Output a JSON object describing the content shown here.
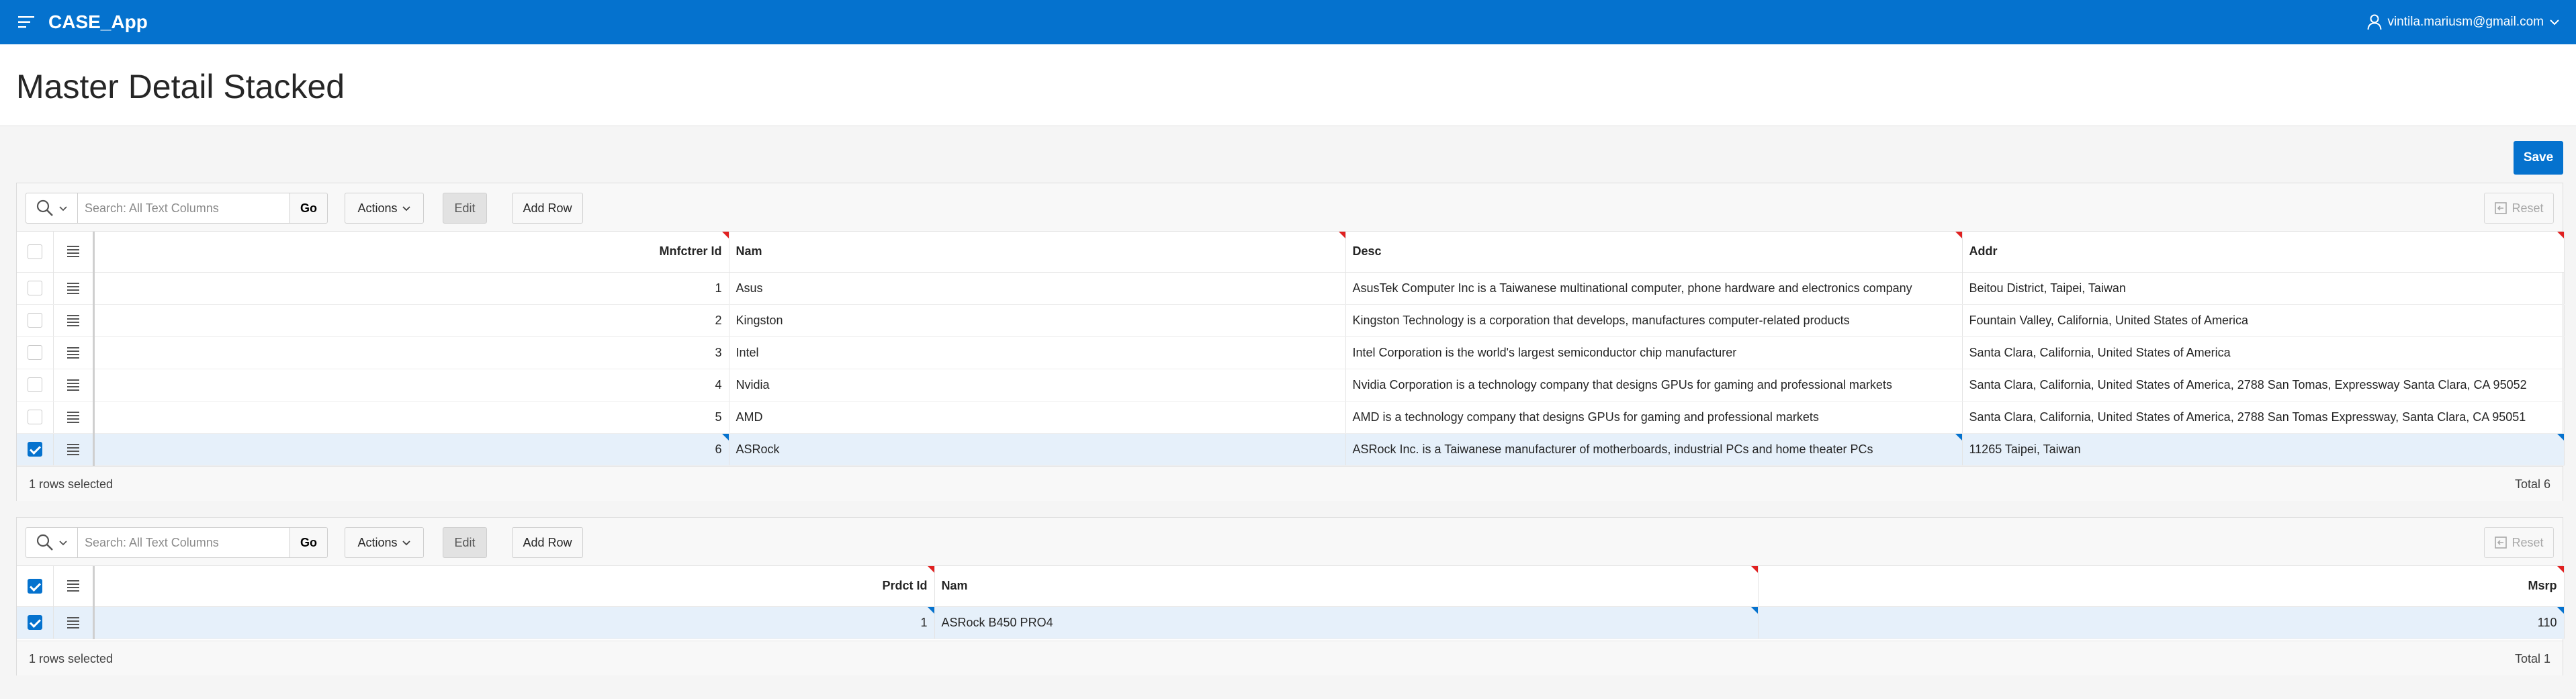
{
  "app": {
    "title": "CASE_App",
    "user": "vintila.mariusm@gmail.com"
  },
  "page": {
    "title": "Master Detail Stacked",
    "save_label": "Save"
  },
  "colors": {
    "brand": "#0572ce",
    "selected_row": "#e6f0fa",
    "changed_marker": "#e02020"
  },
  "master": {
    "toolbar": {
      "search_placeholder": "Search: All Text Columns",
      "go_label": "Go",
      "actions_label": "Actions",
      "edit_label": "Edit",
      "add_row_label": "Add Row",
      "reset_label": "Reset"
    },
    "columns": [
      "Mnfctrer Id",
      "Nam",
      "Desc",
      "Addr"
    ],
    "rows": [
      {
        "id": "1",
        "nam": "Asus",
        "desc": "AsusTek Computer Inc is a Taiwanese multinational computer, phone hardware and electronics company",
        "addr": "Beitou District, Taipei, Taiwan",
        "selected": false
      },
      {
        "id": "2",
        "nam": "Kingston",
        "desc": "Kingston Technology is a corporation that develops, manufactures computer-related products",
        "addr": "Fountain Valley, California, United States of America",
        "selected": false
      },
      {
        "id": "3",
        "nam": "Intel",
        "desc": "Intel Corporation is the world's largest semiconductor chip manufacturer",
        "addr": "Santa Clara, California, United States of America",
        "selected": false
      },
      {
        "id": "4",
        "nam": "Nvidia",
        "desc": "Nvidia Corporation is a technology company that designs GPUs for gaming and professional markets",
        "addr": "Santa Clara, California, United States of America, 2788 San Tomas, Expressway Santa Clara, CA 95052",
        "selected": false
      },
      {
        "id": "5",
        "nam": "AMD",
        "desc": "AMD is a technology company that designs GPUs for gaming and professional markets",
        "addr": "Santa Clara, California, United States of America, 2788 San Tomas Expressway, Santa Clara, CA 95051",
        "selected": false
      },
      {
        "id": "6",
        "nam": "ASRock",
        "desc": "ASRock Inc. is a Taiwanese manufacturer of motherboards, industrial PCs and home theater PCs",
        "addr": "11265 Taipei, Taiwan",
        "selected": true
      }
    ],
    "footer": {
      "selected_text": "1 rows selected",
      "total_text": "Total 6"
    }
  },
  "detail": {
    "toolbar": {
      "search_placeholder": "Search: All Text Columns",
      "go_label": "Go",
      "actions_label": "Actions",
      "edit_label": "Edit",
      "add_row_label": "Add Row",
      "reset_label": "Reset"
    },
    "columns": [
      "Prdct Id",
      "Nam",
      "Msrp"
    ],
    "rows": [
      {
        "id": "1",
        "nam": "ASRock B450 PRO4",
        "msrp": "110",
        "selected": true
      }
    ],
    "footer": {
      "selected_text": "1 rows selected",
      "total_text": "Total 1"
    }
  }
}
